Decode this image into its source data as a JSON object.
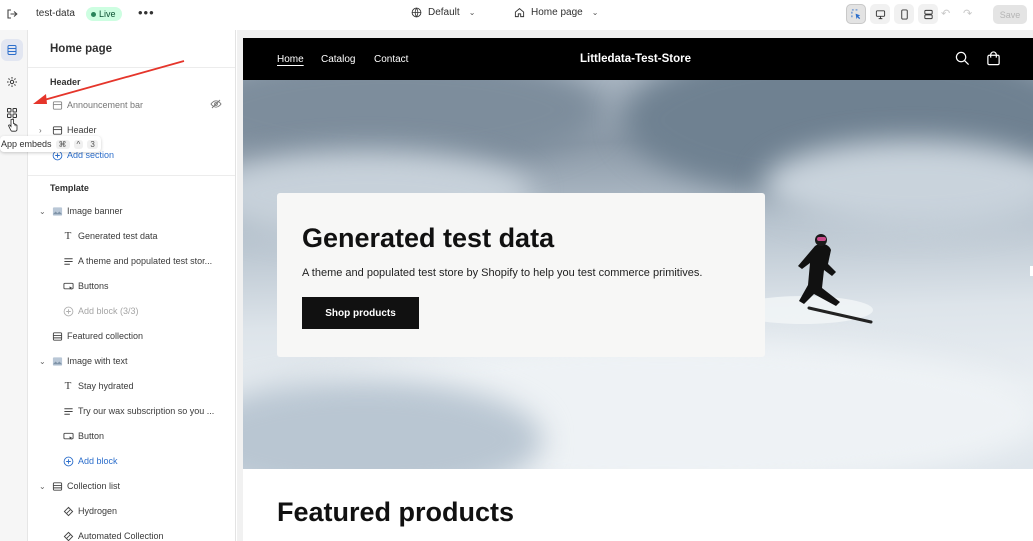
{
  "topbar": {
    "store_name": "test-data",
    "status": "Live",
    "theme_label": "Default",
    "page_label": "Home page",
    "save_label": "Save"
  },
  "rail": {
    "tooltip_label": "App embeds",
    "tooltip_keys": [
      "⌘",
      "^",
      "3"
    ]
  },
  "sidebar": {
    "title": "Home page",
    "header_group": "Header",
    "header_items": [
      {
        "label": "Announcement bar"
      },
      {
        "label": "Header"
      }
    ],
    "add_section_label": "Add section",
    "template_group": "Template",
    "template_items": [
      {
        "label": "Image banner"
      },
      {
        "label": "Generated test data"
      },
      {
        "label": "A theme and populated test stor..."
      },
      {
        "label": "Buttons"
      },
      {
        "label": "Add block (3/3)"
      },
      {
        "label": "Featured collection"
      },
      {
        "label": "Image with text"
      },
      {
        "label": "Stay hydrated"
      },
      {
        "label": "Try our wax subscription so you ..."
      },
      {
        "label": "Button"
      },
      {
        "label": "Add block"
      },
      {
        "label": "Collection list"
      },
      {
        "label": "Hydrogen"
      },
      {
        "label": "Automated Collection"
      }
    ]
  },
  "store": {
    "nav_links": [
      "Home",
      "Catalog",
      "Contact"
    ],
    "brand": "Littledata-Test-Store",
    "hero_title": "Generated test data",
    "hero_text": "A theme and populated test store by Shopify to help you test commerce primitives.",
    "hero_button": "Shop products",
    "featured_title": "Featured products"
  },
  "colors": {
    "accent_blue": "#2c6ecb",
    "live_badge_bg": "#cdfee1",
    "nav_bg": "#000000",
    "annotation_arrow": "#e5352b"
  }
}
